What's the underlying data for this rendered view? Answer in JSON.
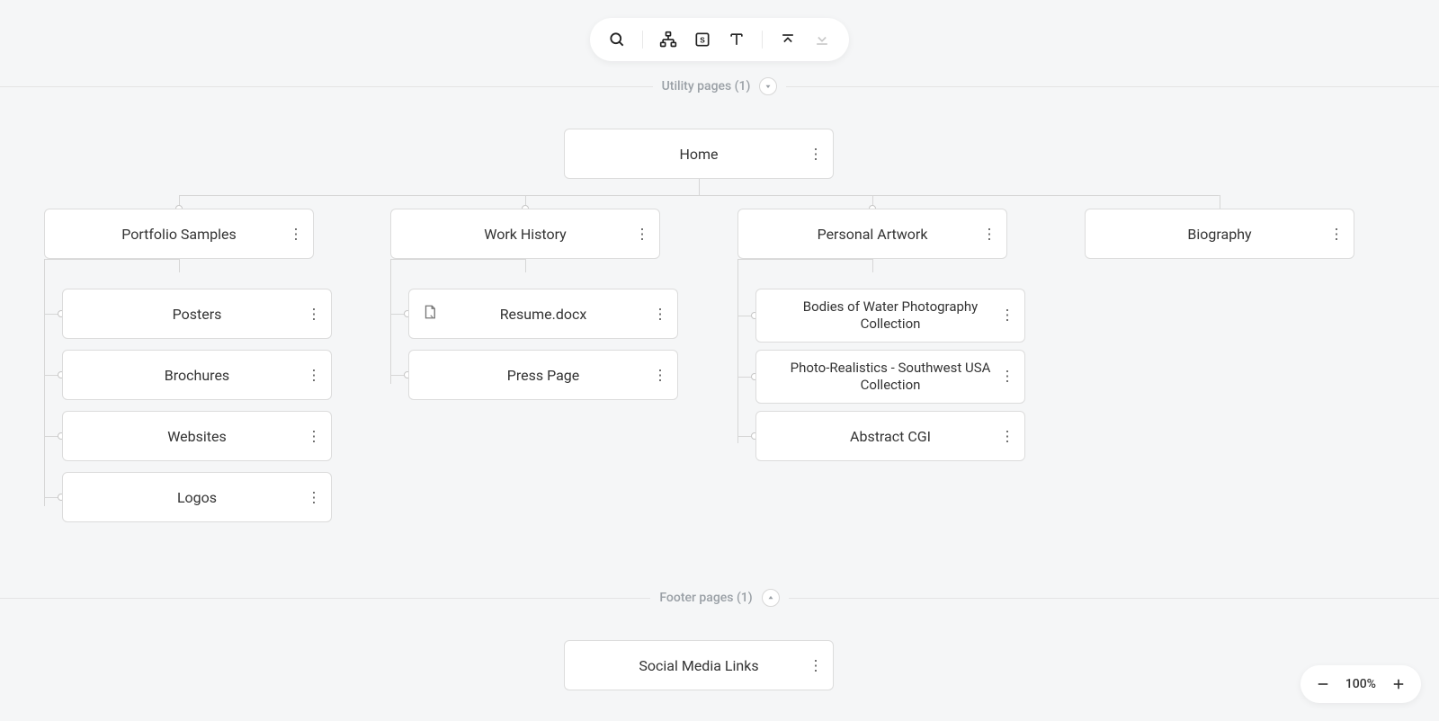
{
  "sections": {
    "utility_label": "Utility pages (1)",
    "footer_label": "Footer pages (1)"
  },
  "root": {
    "label": "Home"
  },
  "level1": {
    "portfolio": {
      "label": "Portfolio Samples"
    },
    "work": {
      "label": "Work History"
    },
    "artwork": {
      "label": "Personal Artwork"
    },
    "bio": {
      "label": "Biography"
    }
  },
  "children": {
    "portfolio": [
      "Posters",
      "Brochures",
      "Websites",
      "Logos"
    ],
    "work": [
      "Resume.docx",
      "Press Page"
    ],
    "artwork": [
      "Bodies of Water Photography Collection",
      "Photo-Realistics - Southwest USA Collection",
      "Abstract CGI"
    ]
  },
  "footer": {
    "label": "Social Media Links"
  },
  "zoom": {
    "level": "100%"
  }
}
